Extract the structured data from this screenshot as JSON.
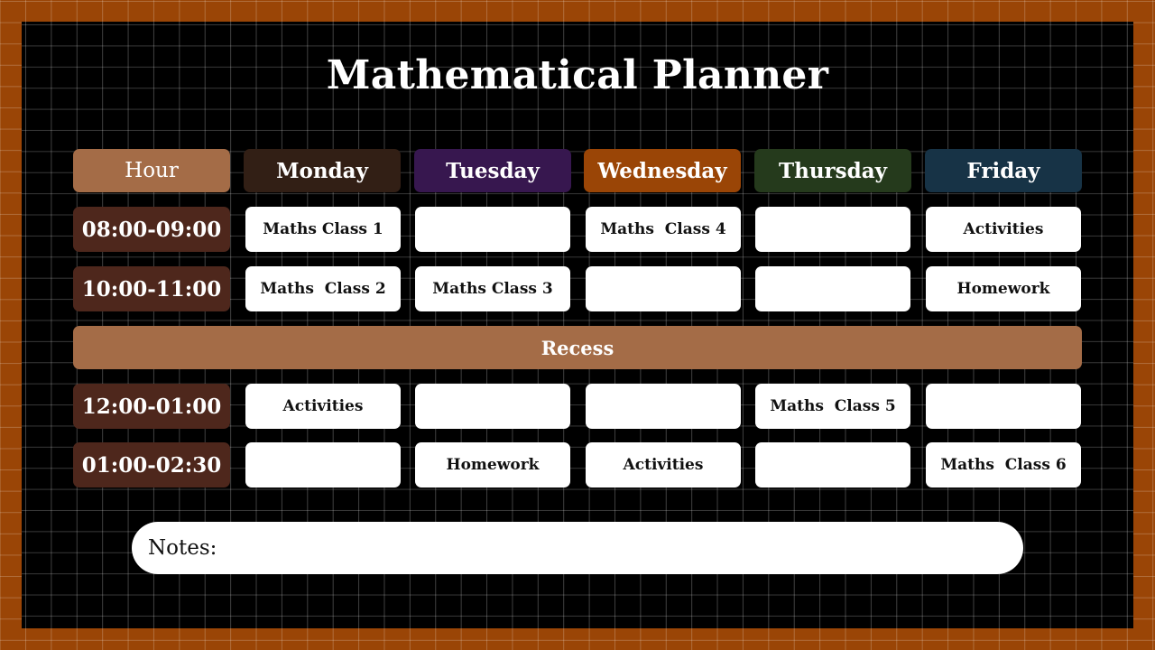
{
  "title": "Mathematical Planner",
  "colors": {
    "frame": "#9a4506",
    "board": "#000000",
    "hour_header": "#a46c47",
    "time_cell": "#4e271c",
    "recess": "#a46c47",
    "monday": "#321f15",
    "tuesday": "#37174f",
    "wednesday": "#9a4506",
    "thursday": "#253a1c",
    "friday": "#173346"
  },
  "header": {
    "hour": "Hour",
    "days": [
      "Monday",
      "Tuesday",
      "Wednesday",
      "Thursday",
      "Friday"
    ]
  },
  "rows": [
    {
      "time": "08:00-09:00",
      "slots": [
        "Maths Class 1",
        "",
        "Maths  Class 4",
        "",
        "Activities"
      ]
    },
    {
      "time": "10:00-11:00",
      "slots": [
        "Maths  Class 2",
        "Maths Class 3",
        "",
        "",
        "Homework"
      ]
    },
    {
      "time": "12:00-01:00",
      "slots": [
        "Activities",
        "",
        "",
        "Maths  Class 5",
        ""
      ]
    },
    {
      "time": "01:00-02:30",
      "slots": [
        "",
        "Homework",
        "Activities",
        "",
        "Maths  Class 6"
      ]
    }
  ],
  "recess": "Recess",
  "notes": {
    "label": "Notes:"
  }
}
